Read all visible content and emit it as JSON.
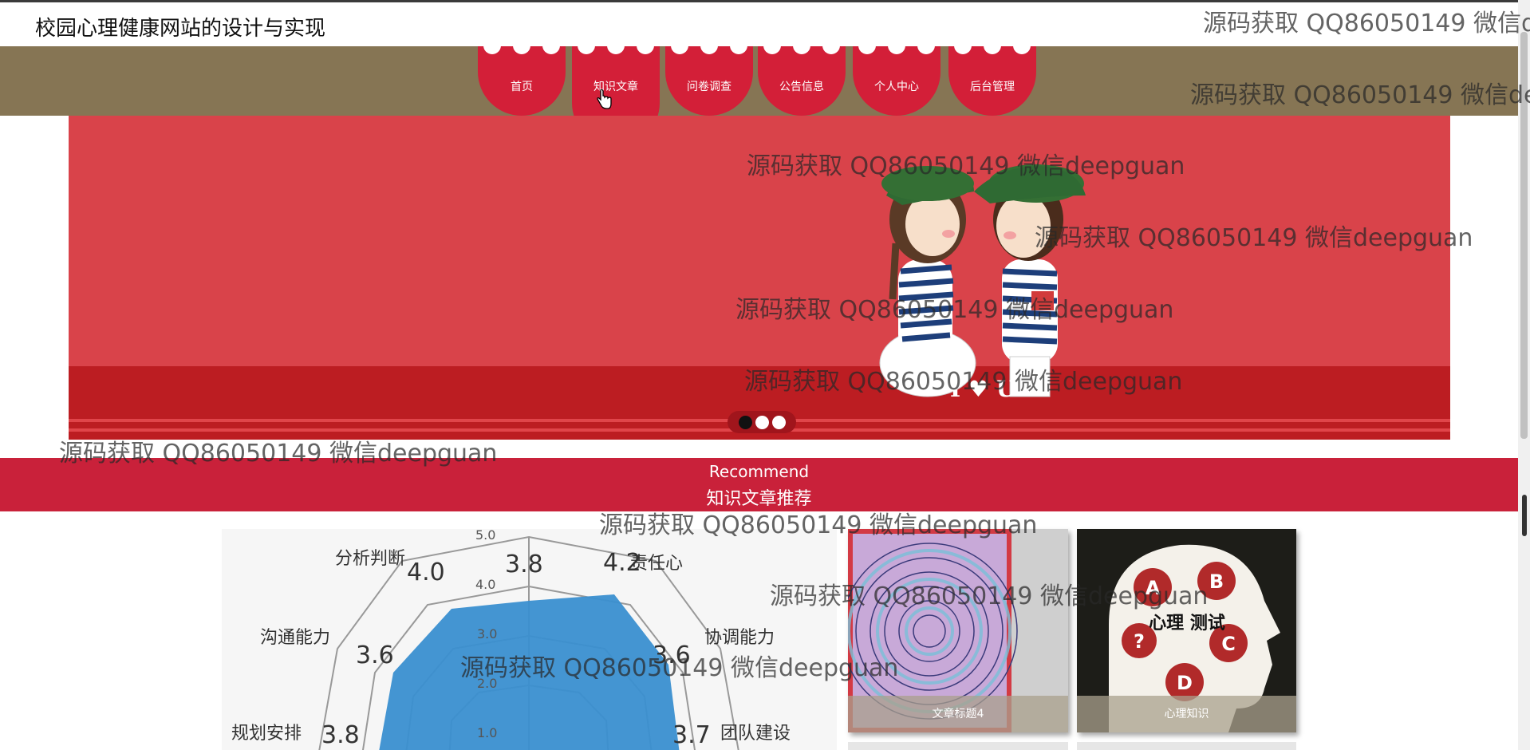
{
  "header": {
    "title": "校园心理健康网站的设计与实现"
  },
  "nav": {
    "items": [
      {
        "label": "首页"
      },
      {
        "label": "知识文章"
      },
      {
        "label": "问卷调查"
      },
      {
        "label": "公告信息"
      },
      {
        "label": "个人中心"
      },
      {
        "label": "后台管理"
      }
    ],
    "active_index": 1
  },
  "banner": {
    "slides_count": 3,
    "active_slide": 1,
    "text": "I ♥ U"
  },
  "recommend": {
    "title_en": "Recommend",
    "title_cn": "知识文章推荐"
  },
  "radar": {
    "ticks": [
      "5.0",
      "4.0",
      "3.0",
      "2.0",
      "1.0"
    ],
    "labels": [
      {
        "name": "分析判断",
        "value": "4.0"
      },
      {
        "name": "",
        "value": "3.8"
      },
      {
        "name": "责任心",
        "value": "4.2"
      },
      {
        "name": "沟通能力",
        "value": "3.6"
      },
      {
        "name": "协调能力",
        "value": "3.6"
      },
      {
        "name": "规划安排",
        "value": "3.8"
      },
      {
        "name": "团队建设",
        "value": "3.7"
      }
    ]
  },
  "articles": [
    {
      "caption": "文章标题4"
    },
    {
      "caption": "心理知识",
      "image_text": "心理 测试",
      "letters": [
        "A",
        "B",
        "?",
        "C",
        "D"
      ]
    }
  ],
  "watermark": "源码获取 QQ86050149 微信deepguan",
  "watermark_clipped": "源码获取 QQ86050149 微信d",
  "watermark_clipped2": "源码获取 QQ86050149 微信de",
  "colors": {
    "nav_bg": "#867554",
    "accent_red": "#d31f38",
    "banner_red": "#d9434a",
    "recommend_bar": "#c9213a"
  }
}
